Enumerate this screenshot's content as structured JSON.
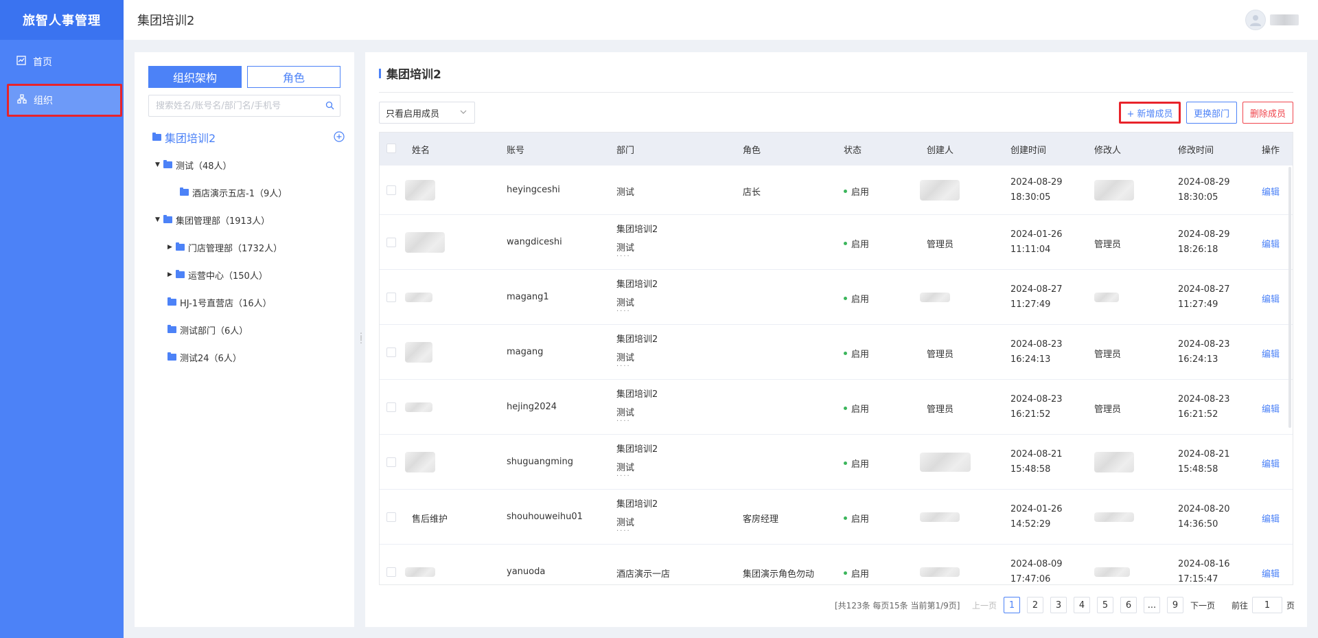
{
  "app": {
    "brand": "旅智人事管理"
  },
  "sidebar": {
    "items": [
      {
        "label": "首页",
        "icon": "chart-icon"
      },
      {
        "label": "组织",
        "icon": "org-chart-icon",
        "active": true
      }
    ]
  },
  "header": {
    "title": "集团培训2"
  },
  "left_panel": {
    "tabs": {
      "org": "组织架构",
      "role": "角色"
    },
    "search_placeholder": "搜索姓名/账号名/部门名/手机号",
    "root": "集团培训2",
    "tree": [
      {
        "label": "测试（48人）"
      },
      {
        "label": "酒店演示五店-1（9人）"
      },
      {
        "label": "集团管理部（1913人）"
      },
      {
        "label": "门店管理部（1732人）"
      },
      {
        "label": "运营中心（150人）"
      },
      {
        "label": "HJ-1号直营店（16人）"
      },
      {
        "label": "测试部门（6人）"
      },
      {
        "label": "测试24（6人）"
      }
    ]
  },
  "main": {
    "title": "集团培训2",
    "filter": "只看启用成员",
    "buttons": {
      "add": "+ 新增成员",
      "change_dept": "更换部门",
      "delete": "删除成员"
    },
    "columns": [
      "姓名",
      "账号",
      "部门",
      "角色",
      "状态",
      "创建人",
      "创建时间",
      "修改人",
      "修改时间",
      "操作"
    ],
    "rows": [
      {
        "name": "",
        "account": "heyingceshi",
        "dept1": "测试",
        "dept2": "",
        "more": "",
        "role": "店长",
        "status": "启用",
        "creator": "",
        "created_date": "2024-08-29",
        "created_time": "18:30:05",
        "modifier": "",
        "modified_date": "2024-08-29",
        "modified_time": "18:30:05",
        "action": "编辑"
      },
      {
        "name": "",
        "account": "wangdiceshi",
        "dept1": "集团培训2",
        "dept2": "测试",
        "more": "····",
        "role": "",
        "status": "启用",
        "creator": "管理员",
        "created_date": "2024-01-26",
        "created_time": "11:11:04",
        "modifier": "管理员",
        "modified_date": "2024-08-29",
        "modified_time": "18:26:18",
        "action": "编辑"
      },
      {
        "name": "",
        "account": "magang1",
        "dept1": "集团培训2",
        "dept2": "测试",
        "more": "····",
        "role": "",
        "status": "启用",
        "creator": "",
        "created_date": "2024-08-27",
        "created_time": "11:27:49",
        "modifier": "",
        "modified_date": "2024-08-27",
        "modified_time": "11:27:49",
        "action": "编辑"
      },
      {
        "name": "",
        "account": "magang",
        "dept1": "集团培训2",
        "dept2": "测试",
        "more": "····",
        "role": "",
        "status": "启用",
        "creator": "管理员",
        "created_date": "2024-08-23",
        "created_time": "16:24:13",
        "modifier": "管理员",
        "modified_date": "2024-08-23",
        "modified_time": "16:24:13",
        "action": "编辑"
      },
      {
        "name": "",
        "account": "hejing2024",
        "dept1": "集团培训2",
        "dept2": "测试",
        "more": "····",
        "role": "",
        "status": "启用",
        "creator": "管理员",
        "created_date": "2024-08-23",
        "created_time": "16:21:52",
        "modifier": "管理员",
        "modified_date": "2024-08-23",
        "modified_time": "16:21:52",
        "action": "编辑"
      },
      {
        "name": "",
        "account": "shuguangming",
        "dept1": "集团培训2",
        "dept2": "测试",
        "more": "····",
        "role": "",
        "status": "启用",
        "creator": "",
        "created_date": "2024-08-21",
        "created_time": "15:48:58",
        "modifier": "",
        "modified_date": "2024-08-21",
        "modified_time": "15:48:58",
        "action": "编辑"
      },
      {
        "name": "售后维护",
        "account": "shouhouweihu01",
        "dept1": "集团培训2",
        "dept2": "测试",
        "more": "····",
        "role": "客房经理",
        "status": "启用",
        "creator": "",
        "created_date": "2024-01-26",
        "created_time": "14:52:29",
        "modifier": "",
        "modified_date": "2024-08-20",
        "modified_time": "14:36:50",
        "action": "编辑"
      },
      {
        "name": "",
        "account": "yanuoda",
        "dept1": "酒店演示一店",
        "dept2": "",
        "more": "",
        "role": "集团演示角色勿动",
        "status": "启用",
        "creator": "",
        "created_date": "2024-08-09",
        "created_time": "17:47:06",
        "modifier": "",
        "modified_date": "2024-08-16",
        "modified_time": "17:15:47",
        "action": "编辑"
      }
    ],
    "pagination": {
      "summary": "[共123条 每页15条 当前第1/9页]",
      "prev": "上一页",
      "pages": [
        "1",
        "2",
        "3",
        "4",
        "5",
        "6",
        "...",
        "9"
      ],
      "current_page": "1",
      "next": "下一页",
      "goto_label": "前往",
      "goto_value": "1",
      "page_unit": "页"
    }
  },
  "colors": {
    "primary": "#4c82f7",
    "danger": "#f0444c",
    "highlight": "#e8232a",
    "success": "#3bb55b"
  }
}
